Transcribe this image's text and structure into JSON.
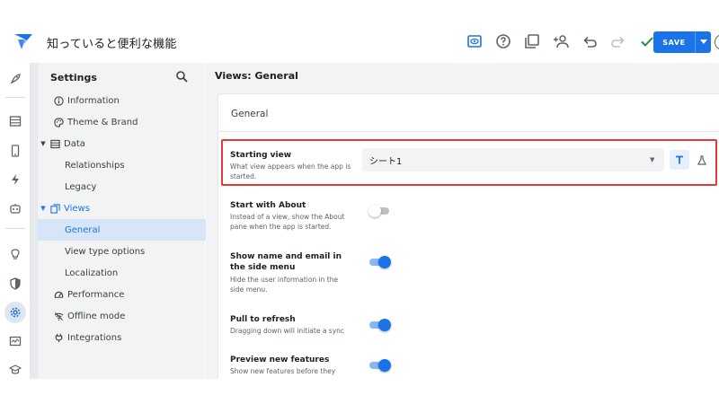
{
  "header": {
    "app_title": "知っていると便利な機能",
    "save_label": "SAVE"
  },
  "sidebar": {
    "title": "Settings",
    "items": [
      {
        "label": "Information"
      },
      {
        "label": "Theme & Brand"
      },
      {
        "label": "Data"
      },
      {
        "label": "Relationships"
      },
      {
        "label": "Legacy"
      },
      {
        "label": "Views"
      },
      {
        "label": "General"
      },
      {
        "label": "View type options"
      },
      {
        "label": "Localization"
      },
      {
        "label": "Performance"
      },
      {
        "label": "Offline mode"
      },
      {
        "label": "Integrations"
      }
    ]
  },
  "main": {
    "title": "Views: General",
    "panel_title": "General",
    "starting_view": {
      "label": "Starting view",
      "description": "What view appears when the app is started.",
      "value": "シート1"
    },
    "settings": [
      {
        "label": "Start with About",
        "description": "Instead of a view, show the About pane when the app is started.",
        "enabled": false
      },
      {
        "label": "Show name and email in the side menu",
        "description": "Hide the user information in the side menu.",
        "enabled": true
      },
      {
        "label": "Pull to refresh",
        "description": "Dragging down will initiate a sync",
        "enabled": true
      },
      {
        "label": "Preview new features",
        "description": "Show new features before they",
        "enabled": true
      }
    ]
  },
  "colors": {
    "accent": "#1a73e8",
    "highlight_border": "#e53935",
    "sidebar_bg": "#f1f3f4",
    "selected_bg": "#d7e5f8"
  },
  "icons": {
    "top": [
      "preview-icon",
      "help-icon",
      "copy-icon",
      "add-person-icon",
      "undo-icon",
      "redo-icon",
      "check-icon"
    ],
    "rail": [
      "rocket-icon",
      "table-icon",
      "mobile-icon",
      "bolt-icon",
      "bot-icon",
      "bulb-icon",
      "shield-icon",
      "gear-icon",
      "monitor-icon",
      "school-icon"
    ]
  }
}
